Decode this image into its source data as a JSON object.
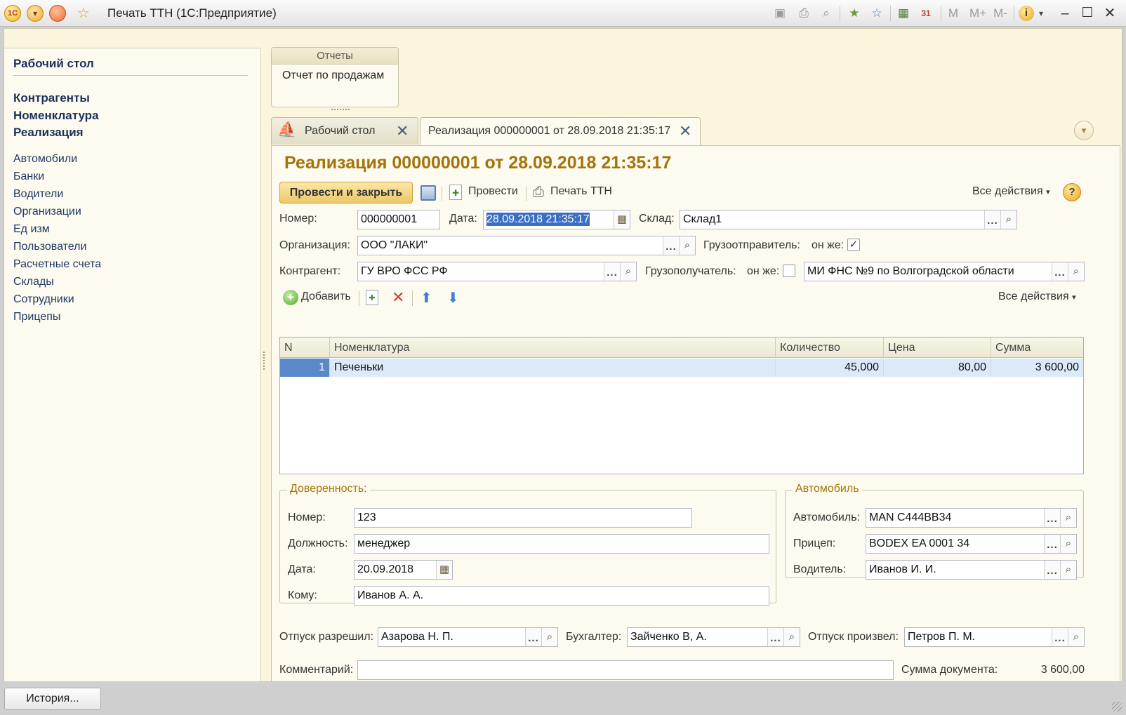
{
  "window": {
    "title": "Печать ТТН  (1С:Предприятие)",
    "toolbar_icons": [
      "save-icon",
      "print-icon",
      "preview-icon",
      "favorite-add-icon",
      "favorites-icon",
      "calculator-icon",
      "calendar-icon",
      "memory-m-icon",
      "memory-plus-icon",
      "memory-minus-icon",
      "info-icon",
      "minimize-icon",
      "maximize-icon",
      "close-icon"
    ],
    "memory": [
      "M",
      "M+",
      "M-"
    ]
  },
  "sidebar": {
    "home": "Рабочий стол",
    "main_sections": [
      "Контрагенты",
      "Номенклатура",
      "Реализация"
    ],
    "catalogs": [
      "Автомобили",
      "Банки",
      "Водители",
      "Организации",
      "Ед изм",
      "Пользователи",
      "Расчетные счета",
      "Склады",
      "Сотрудники",
      "Прицепы"
    ]
  },
  "reports": {
    "title": "Отчеты",
    "items": [
      "Отчет по продажам"
    ]
  },
  "tabs": [
    {
      "label": "Рабочий стол"
    },
    {
      "label": "Реализация 000000001 от 28.09.2018 21:35:17"
    }
  ],
  "document": {
    "title": "Реализация 000000001 от 28.09.2018 21:35:17",
    "toolbar": {
      "post_close": "Провести и закрыть",
      "post": "Провести",
      "print_ttn": "Печать ТТН",
      "all_actions": "Все действия"
    },
    "fields": {
      "number_label": "Номер:",
      "number": "000000001",
      "date_label": "Дата:",
      "date": "28.09.2018 21:35:17",
      "warehouse_label": "Склад:",
      "warehouse": "Склад1",
      "org_label": "Организация:",
      "org": "ООО \"ЛАКИ\"",
      "shipper_label": "Грузоотправитель:",
      "shipper_same_label": "он же:",
      "shipper_same": true,
      "counterparty_label": "Контрагент:",
      "counterparty": "ГУ ВРО ФСС РФ",
      "consignee_label": "Грузополучатель:",
      "consignee_same_label": "он же:",
      "consignee_same": false,
      "consignee": "МИ ФНС №9 по Волгоградской области"
    },
    "table_toolbar": {
      "add": "Добавить",
      "all_actions": "Все действия"
    },
    "table": {
      "columns": [
        "N",
        "Номенклатура",
        "Количество",
        "Цена",
        "Сумма"
      ],
      "rows": [
        {
          "n": "1",
          "item": "Печеньки",
          "qty": "45,000",
          "price": "80,00",
          "sum": "3 600,00"
        }
      ]
    },
    "power_of_attorney": {
      "title": "Доверенность:",
      "number_label": "Номер:",
      "number": "123",
      "position_label": "Должность:",
      "position": "менеджер",
      "date_label": "Дата:",
      "date": "20.09.2018",
      "to_label": "Кому:",
      "to": "Иванов А. А."
    },
    "vehicle": {
      "title": "Автомобиль",
      "car_label": "Автомобиль:",
      "car": "MAN C444BB34",
      "trailer_label": "Прицеп:",
      "trailer": "BODEX EA 0001 34",
      "driver_label": "Водитель:",
      "driver": "Иванов И. И."
    },
    "signatures": {
      "released_by_label": "Отпуск разрешил:",
      "released_by": "Азарова Н. П.",
      "accountant_label": "Бухгалтер:",
      "accountant": "Зайченко В, А.",
      "produced_by_label": "Отпуск произвел:",
      "produced_by": "Петров П. М."
    },
    "comment_label": "Комментарий:",
    "comment": "",
    "total_label": "Сумма документа:",
    "total": "3 600,00"
  },
  "footer": {
    "history_button": "История..."
  }
}
